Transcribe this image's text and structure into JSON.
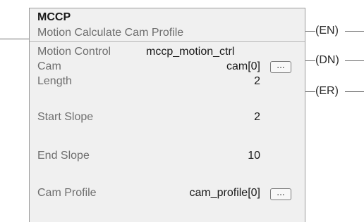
{
  "instruction": {
    "mnemonic": "MCCP",
    "description": "Motion Calculate Cam Profile"
  },
  "operands": [
    {
      "label": "Motion Control",
      "value": "mccp_motion_ctrl"
    },
    {
      "label": "Cam",
      "value": "cam[0]",
      "browse": true
    },
    {
      "label": "Length",
      "value": "2"
    },
    {
      "label": "Start Slope",
      "value": "2"
    },
    {
      "label": "End Slope",
      "value": "10"
    },
    {
      "label": "Cam Profile",
      "value": "cam_profile[0]",
      "browse": true
    }
  ],
  "browse_button": {
    "label": "..."
  },
  "outputs": [
    {
      "name": "EN"
    },
    {
      "name": "DN"
    },
    {
      "name": "ER"
    }
  ]
}
